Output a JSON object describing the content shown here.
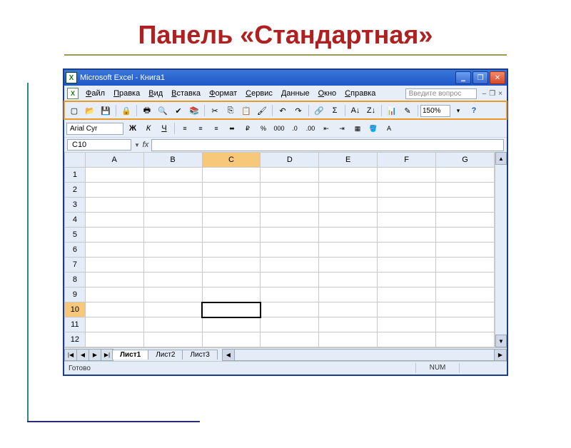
{
  "slide": {
    "title": "Панель «Стандартная»"
  },
  "titlebar": {
    "app_icon": "X",
    "text": "Microsoft Excel - Книга1"
  },
  "menu": {
    "icon": "X",
    "items": [
      "Файл",
      "Правка",
      "Вид",
      "Вставка",
      "Формат",
      "Сервис",
      "Данные",
      "Окно",
      "Справка"
    ],
    "help_placeholder": "Введите вопрос"
  },
  "standard_toolbar": {
    "buttons": [
      "new",
      "open",
      "save",
      "permission",
      "print",
      "print-preview",
      "spelling",
      "research",
      "cut",
      "copy",
      "paste",
      "format-painter",
      "undo",
      "redo",
      "hyperlink",
      "autosum",
      "sort-asc",
      "sort-desc",
      "chart-wizard",
      "drawing"
    ],
    "zoom": "150%",
    "help_btn": "help"
  },
  "format_toolbar": {
    "font": "Arial Cyr",
    "buttons_left": [
      "bold",
      "italic",
      "underline"
    ],
    "buttons_right": [
      "align-left",
      "align-center",
      "align-right",
      "merge",
      "currency",
      "percent",
      "comma",
      "inc-dec",
      "dec-dec",
      "dec-indent",
      "inc-indent",
      "borders",
      "fill-color",
      "font-color"
    ]
  },
  "cell_ref": "C10",
  "columns": [
    "A",
    "B",
    "C",
    "D",
    "E",
    "F",
    "G"
  ],
  "rows": [
    1,
    2,
    3,
    4,
    5,
    6,
    7,
    8,
    9,
    10,
    11,
    12
  ],
  "selected_col": "C",
  "selected_row": 10,
  "sheets": [
    "Лист1",
    "Лист2",
    "Лист3"
  ],
  "active_sheet": "Лист1",
  "status": {
    "ready": "Готово",
    "num": "NUM"
  }
}
